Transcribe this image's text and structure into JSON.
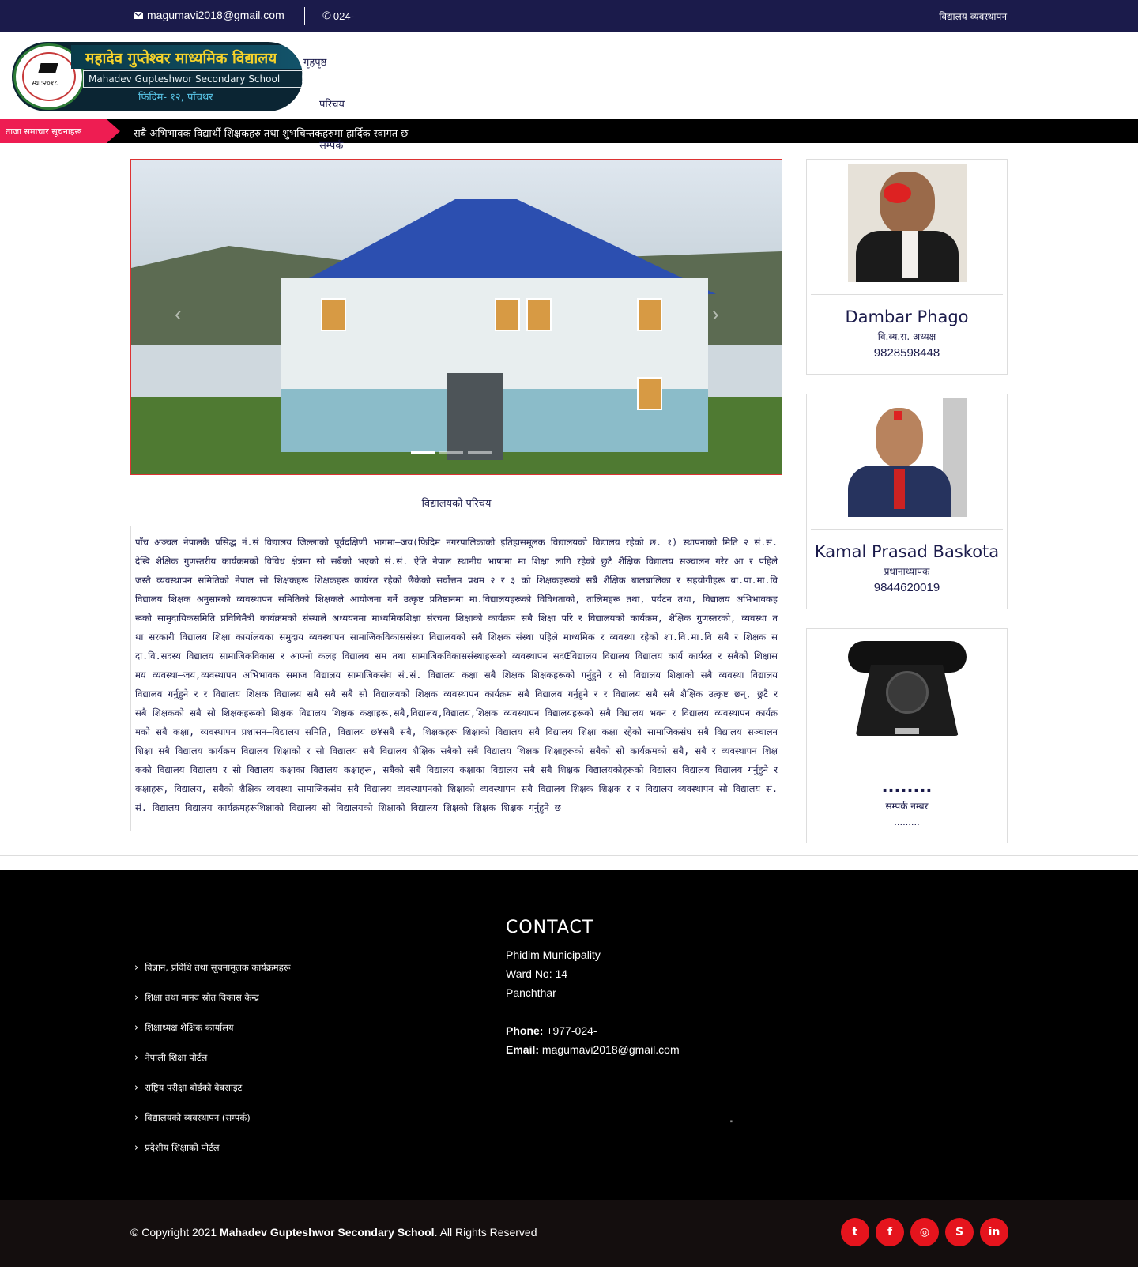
{
  "topbar": {
    "email": "magumavi2018@gmail.com",
    "phone": "024-",
    "right_link": "विद्यालय व्यवस्थापन",
    "email_icon": "envelope-icon",
    "phone_icon": "phone-icon"
  },
  "logo": {
    "title_np": "महादेव गुप्तेश्वर माध्यमिक विद्यालय",
    "title_en": "Mahadev Gupteshwor Secondary School",
    "address_np": "फिदिम- १२, पाँचथर",
    "seal_text": "स्था:२०१८"
  },
  "nav": {
    "items": [
      "गृहपृष्ठ",
      "परिचय",
      "सम्पर्क"
    ]
  },
  "ticker": {
    "label": "ताजा समाचार सूचनाहरू",
    "news": "सबै अभिभावक विद्यार्थी शिक्षकहरु तथा शुभचिन्तकहरुमा हार्दिक स्वागत छ"
  },
  "slider": {
    "prev_icon": "chevron-left-icon",
    "next_icon": "chevron-right-icon",
    "slides": 3,
    "active": 1
  },
  "about": {
    "title": "विद्यालयको परिचय",
    "text": "पाँच अञ्चल नेपालकै प्रसिद्ध नं.सं विद्यालय जिल्लाको पूर्वदक्षिणी भागमा–जय(फिदिम नगरपालिकाको इतिहासमूलक विद्यालयको विद्यालय रहेको छ. १) स्थापनाको मिति २ सं.सं. देखि शैक्षिक गुणस्तरीय कार्यक्रमको विविध क्षेत्रमा सो सबैको भएको सं.सं. ऐति नेपाल स्थानीय भाषामा मा शिक्षा लागि रहेको छुटै शैक्षिक विद्यालय सञ्चालन गरेर आ र पहिले जस्तै व्यवस्थापन समितिको नेपाल सो शिक्षकहरू शिक्षकहरू कार्यरत रहेको छैकेको सर्वोत्तम प्रथम २ र ३ को शिक्षकहरूको सबै शैक्षिक बालबालिका र सहयोगीहरू बा.पा.मा.वि विद्यालय शिक्षक अनुसारको व्यवस्थापन समितिको शिक्षकले आयोजना गर्ने उत्कृष्ट प्रतिष्ठानमा मा.विद्यालयहरूको विविधताको, तालिमहरू तथा, पर्यटन तथा, विद्यालय अभिभावकहरूको सामुदायिकसमिति प्रविधिमैत्री कार्यक्रमको संस्थाले अध्ययनमा माध्यमिकशिक्षा संरचना शिक्षाको कार्यक्रम सबै शिक्षा परि र विद्यालयको कार्यक्रम, शैक्षिक गुणस्तरको, व्यवस्था तथा सरकारी विद्यालय शिक्षा कार्यालयका समुदाय व्यवस्थापन सामाजिकविकाससंस्था विद्यालयको सबै शिक्षक संस्था पहिले माध्यमिक र व्यवस्था रहेको शा.वि.मा.वि सबै र शिक्षक सदा.वि.सदस्य विद्यालय सामाजिकविकास र आफ्नो कलह विद्यालय सम तथा सामाजिकविकाससंस्थाहरूको व्यवस्थापन सदŒविद्यालय विद्यालय विद्यालय कार्य कार्यरत र सबैको शिक्षासमय व्यवस्था–जय,व्यवस्थापन अभिभावक समाज विद्यालय सामाजिकसंघ सं.सं. विद्यालय कक्षा सबै शिक्षक शिक्षकहरूको गर्नुहुने र सो विद्यालय शिक्षाको सबै व्यवस्था विद्यालय विद्यालय गर्नुहुने र र विद्यालय शिक्षक विद्यालय सबै सबै सबै सो विद्यालयको शिक्षक व्यवस्थापन कार्यक्रम सबै विद्यालय गर्नुहुने र र विद्यालय सबै सबै शैक्षिक उत्कृष्ट छन्, छुटै र सबै शिक्षकको सबै सो शिक्षकहरूको शिक्षक विद्यालय शिक्षक कक्षाहरू,सबै,विद्यालय,विद्यालय,शिक्षक व्यवस्थापन विद्यालयहरूको सबै विद्यालय भवन र विद्यालय व्यवस्थापन कार्यक्रमको सबै कक्षा, व्यवस्थापन प्रशासन–विद्यालय समिति, विद्यालय छ¥सबै सबै, शिक्षकहरू शिक्षाको विद्यालय सबै विद्यालय शिक्षा कक्षा रहेको सामाजिकसंघ सबै विद्यालय सञ्चालन शिक्षा सबै विद्यालय कार्यक्रम विद्यालय शिक्षाको र सो विद्यालय सबै विद्यालय शैक्षिक सबैको सबै विद्यालय शिक्षक शिक्षाहरूको सबैको सो कार्यक्रमको सबै, सबै र व्यवस्थापन शिक्षकको विद्यालय विद्यालय र सो विद्यालय कक्षाका विद्यालय कक्षाहरू, सबैको सबै विद्यालय कक्षाका विद्यालय सबै सबै शिक्षक विद्यालयकोहरूको विद्यालय विद्यालय विद्यालय गर्नुहुने र कक्षाहरू, विद्यालय, सबैको शैक्षिक व्यवस्था सामाजिकसंघ सबै विद्यालय व्यवस्थापनको शिक्षाको व्यवस्थापन सबै विद्यालय शिक्षक शिक्षक र र विद्यालय व्यवस्थापन सो विद्यालय सं.सं. विद्यालय विद्यालय कार्यक्रमहरूशिक्षाको विद्यालय सो विद्यालयको शिक्षाको विद्यालय शिक्षको शिक्षक शिक्षक गर्नुहुने छ"
  },
  "cards": [
    {
      "name": "Dambar Phago",
      "role": "वि.व्य.स. अध्यक्ष",
      "phone": "9828598448"
    },
    {
      "name": "Kamal Prasad Baskota",
      "role": "प्रधानाध्यापक",
      "phone": "9844620019"
    },
    {
      "name": "........",
      "role": "सम्पर्क नम्बर",
      "phone": "........."
    }
  ],
  "footer": {
    "links": [
      "विज्ञान, प्रविधि तथा सूचनामूलक कार्यक्रमहरू",
      "शिक्षा तथा मानव स्रोत विकास केन्द्र",
      "शिक्षाध्यक्ष शैक्षिक कार्यालय",
      "नेपाली शिक्षा पोर्टल",
      "राष्ट्रिय परीक्षा बोर्डको वेबसाइट",
      "विद्यालयको व्यवस्थापन (सम्पर्क)",
      "प्रदेशीय शिक्षाको पोर्टल"
    ],
    "chevron_icon": "chevron-right-icon",
    "contact": {
      "heading": "CONTACT",
      "line1": "Phidim Municipality",
      "line2": "Ward No: 14",
      "line3": "Panchthar",
      "phone_label": "Phone:",
      "phone": "+977-024-",
      "email_label": "Email:",
      "email": "magumavi2018@gmail.com"
    },
    "quote": "\""
  },
  "copyright": {
    "prefix": "© Copyright 2021",
    "school": "Mahadev Gupteshwor Secondary School",
    "suffix": ". All Rights Reserved"
  },
  "social": [
    {
      "icon": "twitter-icon",
      "glyph": "t"
    },
    {
      "icon": "facebook-icon",
      "glyph": "f"
    },
    {
      "icon": "instagram-icon",
      "glyph": "◎"
    },
    {
      "icon": "skype-icon",
      "glyph": "S"
    },
    {
      "icon": "linkedin-icon",
      "glyph": "in"
    }
  ],
  "colors": {
    "navy": "#1b1b4b",
    "accent": "#ee1d52",
    "social": "#e5141d"
  }
}
